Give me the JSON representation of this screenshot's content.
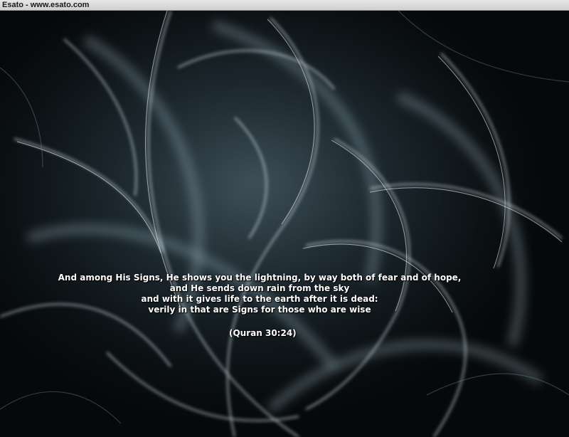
{
  "window": {
    "title": "Esato - www.esato.com"
  },
  "wallpaper": {
    "quote_lines": [
      "And among His Signs, He shows you the lightning, by way both of fear and of hope,",
      "and He sends down rain from the sky",
      "and with it gives life to the earth after it is dead:",
      "verily in that are Signs for those who are wise"
    ],
    "citation": "(Quran 30:24)"
  }
}
